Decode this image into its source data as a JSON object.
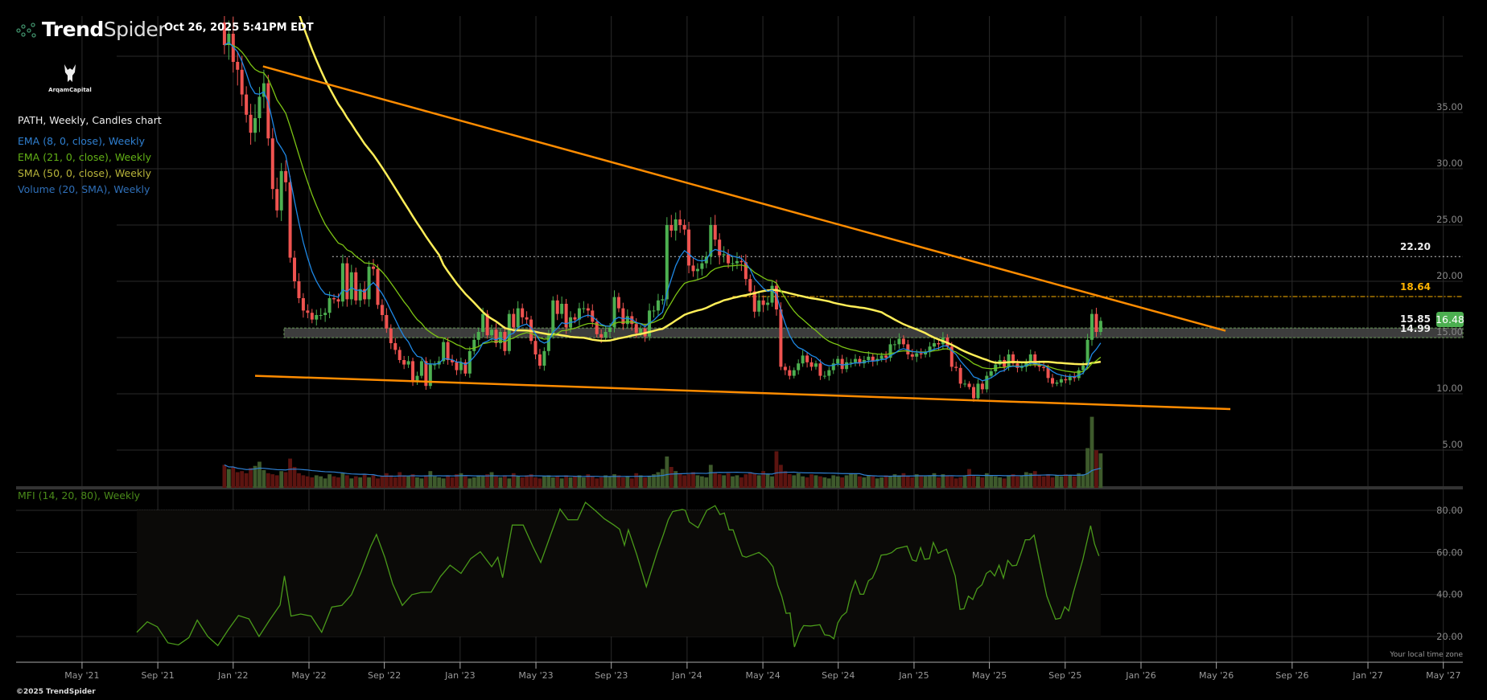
{
  "header": {
    "brand_bold": "Trend",
    "brand_light": "Spider",
    "timestamp": "Oct 26, 2025 5:41PM EDT",
    "watermark": "ArqamCapital"
  },
  "legend": {
    "title": "PATH, Weekly, Candles chart",
    "items": [
      {
        "label": "EMA (8, 0, close), Weekly",
        "color": "#2f7fd0"
      },
      {
        "label": "EMA (21, 0, close), Weekly",
        "color": "#62b016"
      },
      {
        "label": "SMA (50, 0, close), Weekly",
        "color": "#b8b43a"
      },
      {
        "label": "Volume (20, SMA), Weekly",
        "color": "#2f6fb8"
      }
    ]
  },
  "mfi_panel": {
    "label": "MFI (14, 20, 80), Weekly"
  },
  "footer": {
    "timezone_note": "Your local time zone",
    "copyright": "©2025 TrendSpider"
  },
  "colors": {
    "up": "#4caf50",
    "down": "#ef5350",
    "ema8": "#1e88e5",
    "ema21": "#7cc414",
    "sma50": "#ffee58",
    "trend": "#ff8c00",
    "mfi": "#4a9a1a",
    "badge": "#4caf50"
  },
  "chart_data": {
    "type": "candlestick",
    "symbol": "PATH",
    "interval": "Weekly",
    "x_unit": "weeks",
    "first_candle_week": 20,
    "x_ticks": [
      {
        "label": "May '21",
        "week": -12.5
      },
      {
        "label": "Sep '21",
        "week": 4.8
      },
      {
        "label": "Jan '22",
        "week": 22.0
      },
      {
        "label": "May '22",
        "week": 39.3
      },
      {
        "label": "Sep '22",
        "week": 56.5
      },
      {
        "label": "Jan '23",
        "week": 73.8
      },
      {
        "label": "May '23",
        "week": 91.1
      },
      {
        "label": "Sep '23",
        "week": 108.3
      },
      {
        "label": "Jan '24",
        "week": 125.6
      },
      {
        "label": "May '24",
        "week": 142.9
      },
      {
        "label": "Sep '24",
        "week": 160.1
      },
      {
        "label": "Jan '25",
        "week": 177.4
      },
      {
        "label": "May '25",
        "week": 194.6
      },
      {
        "label": "Sep '25",
        "week": 211.9
      },
      {
        "label": "Jan '26",
        "week": 229.2
      },
      {
        "label": "May '26",
        "week": 246.4
      },
      {
        "label": "Sep '26",
        "week": 263.7
      },
      {
        "label": "Jan '27",
        "week": 281.0
      },
      {
        "label": "May '27",
        "week": 298.2
      }
    ],
    "price_ticks": [
      "35.00",
      "30.00",
      "25.00",
      "20.00",
      "15.00",
      "10.00",
      "5.00"
    ],
    "price_gridlines": [
      40,
      35,
      30,
      25,
      20,
      15,
      10,
      5
    ],
    "mfi_ticks": [
      "80.00",
      "60.00",
      "40.00",
      "20.00"
    ],
    "first_open": 43,
    "closes": [
      41,
      42,
      39.5,
      38.8,
      36.6,
      34.8,
      33.2,
      34.5,
      36.4,
      37.6,
      32.7,
      28.2,
      26.3,
      29.8,
      28.8,
      22.1,
      20,
      18.5,
      17.4,
      17.2,
      16.6,
      17,
      17,
      17.2,
      18.5,
      18.4,
      18.2,
      21.6,
      18.4,
      20.8,
      18.3,
      19.3,
      18.4,
      21.3,
      21.1,
      17.9,
      17,
      15.8,
      14.5,
      13.9,
      13,
      12.6,
      12.9,
      11.1,
      11.6,
      12.9,
      10.7,
      12.6,
      12.6,
      12.9,
      14.6,
      13,
      12.8,
      12.1,
      12.8,
      11.8,
      13.8,
      14.8,
      15.5,
      17.1,
      15.2,
      15.7,
      14.5,
      15.5,
      13.8,
      17.1,
      15.9,
      17.6,
      16.8,
      16.6,
      14.7,
      13.5,
      12.5,
      13.8,
      15.2,
      18.3,
      17.1,
      18,
      15.9,
      16.8,
      16.6,
      17.6,
      17.6,
      17.4,
      16.4,
      15.3,
      15,
      15.5,
      15.9,
      18.6,
      17.6,
      16.2,
      16.9,
      16.2,
      15.4,
      15.8,
      15.1,
      17.4,
      17.4,
      18.3,
      18.4,
      25,
      24.5,
      25.5,
      25,
      24.6,
      21.4,
      20.9,
      21.1,
      21.6,
      22.2,
      25,
      23.7,
      22.3,
      22.4,
      21.6,
      21.6,
      21.8,
      21.7,
      20.2,
      19.1,
      17.3,
      18.3,
      17.9,
      18.1,
      19.6,
      17.5,
      12.4,
      12.1,
      11.6,
      12.1,
      12.7,
      13.4,
      12.8,
      12.4,
      12.7,
      11.6,
      11.6,
      12.1,
      12.7,
      13.1,
      12.2,
      12.8,
      12.8,
      13.1,
      12.7,
      13,
      13.3,
      12.9,
      13.1,
      13.4,
      13.2,
      14.4,
      14.4,
      14.9,
      14.4,
      13.5,
      13.3,
      13.6,
      13.5,
      13.7,
      14.2,
      14.5,
      14.4,
      15,
      14.2,
      12.4,
      12.3,
      10.9,
      10.9,
      10.6,
      9.6,
      10.9,
      10.4,
      11.6,
      12,
      12.6,
      13,
      12.4,
      13.5,
      12.7,
      12.3,
      12.4,
      12.8,
      13.5,
      12.6,
      12.4,
      12.3,
      11.4,
      10.9,
      11,
      11.3,
      11.2,
      11.5,
      11.4,
      12.1,
      12.5,
      14.8,
      17.1,
      15.5,
      16.48
    ],
    "volume_millions": [
      22,
      18,
      20,
      15,
      16,
      14,
      19,
      21,
      25,
      17,
      14,
      13,
      12,
      16,
      15,
      28,
      20,
      14,
      12,
      11,
      10,
      12,
      11,
      9,
      13,
      11,
      10,
      14,
      12,
      9,
      11,
      10,
      13,
      10,
      12,
      9,
      11,
      14,
      12,
      10,
      15,
      12,
      11,
      13,
      10,
      9,
      12,
      16,
      11,
      10,
      9,
      12,
      10,
      13,
      14,
      11,
      9,
      10,
      12,
      11,
      13,
      15,
      11,
      10,
      12,
      9,
      14,
      11,
      10,
      12,
      13,
      10,
      9,
      11,
      12,
      10,
      11,
      9,
      12,
      10,
      11,
      12,
      10,
      13,
      11,
      9,
      10,
      12,
      11,
      13,
      12,
      10,
      11,
      9,
      14,
      12,
      10,
      11,
      13,
      15,
      18,
      30,
      20,
      16,
      14,
      12,
      13,
      15,
      12,
      11,
      10,
      22,
      15,
      13,
      12,
      14,
      11,
      12,
      10,
      13,
      15,
      14,
      12,
      16,
      13,
      11,
      35,
      22,
      16,
      13,
      12,
      14,
      11,
      10,
      13,
      12,
      11,
      10,
      9,
      12,
      11,
      10,
      12,
      14,
      13,
      11,
      10,
      12,
      11,
      9,
      10,
      12,
      11,
      13,
      12,
      14,
      11,
      10,
      13,
      12,
      11,
      12,
      14,
      10,
      13,
      12,
      11,
      9,
      10,
      12,
      18,
      12,
      11,
      10,
      14,
      12,
      11,
      10,
      9,
      12,
      13,
      11,
      12,
      15,
      14,
      16,
      12,
      11,
      13,
      10,
      12,
      11,
      13,
      12,
      11,
      14,
      13,
      38,
      68,
      36,
      33
    ],
    "mfi": [
      [
        0,
        22
      ],
      [
        2.4,
        27
      ],
      [
        4.7,
        24.6
      ],
      [
        7.1,
        17
      ],
      [
        9.5,
        16
      ],
      [
        11.9,
        19.5
      ],
      [
        13.8,
        27.8
      ],
      [
        16.2,
        20
      ],
      [
        18.5,
        15.7
      ],
      [
        20.9,
        23.3
      ],
      [
        23.2,
        30
      ],
      [
        25.6,
        28.4
      ],
      [
        27.9,
        20
      ],
      [
        30.3,
        27.8
      ],
      [
        32.7,
        35
      ],
      [
        33.7,
        48.8
      ],
      [
        35.2,
        29.7
      ],
      [
        37.4,
        30.7
      ],
      [
        39.8,
        29.7
      ],
      [
        42.2,
        22
      ],
      [
        44.5,
        34
      ],
      [
        46.8,
        34.8
      ],
      [
        49,
        39.9
      ],
      [
        51.2,
        50.7
      ],
      [
        53.4,
        62.8
      ],
      [
        54.7,
        68.5
      ],
      [
        56.6,
        57.7
      ],
      [
        58.4,
        45
      ],
      [
        60.6,
        34.8
      ],
      [
        62.8,
        39.9
      ],
      [
        65,
        41
      ],
      [
        67.2,
        41.1
      ],
      [
        69.3,
        48.5
      ],
      [
        71.5,
        53.9
      ],
      [
        74,
        50
      ],
      [
        76.2,
        57
      ],
      [
        78.4,
        60.3
      ],
      [
        81,
        53.2
      ],
      [
        82.4,
        57.7
      ],
      [
        83.5,
        48
      ],
      [
        85.7,
        73
      ],
      [
        88.2,
        73
      ],
      [
        90.4,
        62.8
      ],
      [
        92.2,
        55.2
      ],
      [
        94.4,
        68
      ],
      [
        96.6,
        80.6
      ],
      [
        98.4,
        75.5
      ],
      [
        100.6,
        75.5
      ],
      [
        102.4,
        83.8
      ],
      [
        104.6,
        80
      ],
      [
        106.7,
        76
      ],
      [
        108.9,
        73
      ],
      [
        110.2,
        71
      ],
      [
        111.3,
        63.4
      ],
      [
        112.2,
        70.7
      ],
      [
        114.1,
        59
      ],
      [
        116.3,
        43.7
      ],
      [
        118.8,
        60.3
      ],
      [
        120.2,
        68.5
      ],
      [
        121.3,
        75.5
      ],
      [
        122.3,
        79.4
      ],
      [
        124.5,
        80.4
      ],
      [
        125.2,
        80
      ],
      [
        126.1,
        74.5
      ],
      [
        128.1,
        71.7
      ],
      [
        130.1,
        80
      ],
      [
        132,
        82.2
      ],
      [
        133.1,
        78
      ],
      [
        134.1,
        78.7
      ],
      [
        135.2,
        70.7
      ],
      [
        136.1,
        70.7
      ],
      [
        137.2,
        64
      ],
      [
        138.2,
        58.3
      ],
      [
        139.1,
        57.7
      ],
      [
        142,
        60
      ],
      [
        143.8,
        57
      ],
      [
        145.2,
        53.2
      ],
      [
        146.3,
        44.3
      ],
      [
        147.2,
        39.2
      ],
      [
        148.2,
        31
      ],
      [
        149.1,
        31.2
      ],
      [
        150.1,
        15
      ],
      [
        151.3,
        22
      ],
      [
        152.2,
        25.2
      ],
      [
        153.8,
        25
      ],
      [
        155.9,
        25.6
      ],
      [
        157,
        20.8
      ],
      [
        158.1,
        20.5
      ],
      [
        159.1,
        18.9
      ],
      [
        160,
        26.5
      ],
      [
        160.9,
        29.7
      ],
      [
        162,
        31.6
      ],
      [
        163,
        40.5
      ],
      [
        164,
        46.5
      ],
      [
        165.1,
        40.1
      ],
      [
        165.9,
        40.1
      ],
      [
        167,
        46.5
      ],
      [
        167.9,
        47.8
      ],
      [
        168.8,
        52
      ],
      [
        169.9,
        58.7
      ],
      [
        171.1,
        59
      ],
      [
        172.3,
        59.9
      ],
      [
        173.4,
        61.8
      ],
      [
        175.8,
        63
      ],
      [
        177,
        56.4
      ],
      [
        177.9,
        55.8
      ],
      [
        178.9,
        62.2
      ],
      [
        179.8,
        56.7
      ],
      [
        180.9,
        57
      ],
      [
        181.8,
        64.7
      ],
      [
        182.9,
        59.6
      ],
      [
        184.8,
        61.5
      ],
      [
        186.8,
        48.8
      ],
      [
        187.9,
        32.9
      ],
      [
        188.8,
        33.2
      ],
      [
        189.8,
        39.2
      ],
      [
        190.8,
        37.6
      ],
      [
        191.8,
        42.7
      ],
      [
        192.9,
        44.6
      ],
      [
        193.9,
        50
      ],
      [
        194.8,
        51.3
      ],
      [
        195.8,
        48.8
      ],
      [
        196.8,
        53.9
      ],
      [
        197.8,
        47.8
      ],
      [
        198.8,
        56.2
      ],
      [
        199.8,
        53.6
      ],
      [
        200.8,
        53.9
      ],
      [
        201.8,
        59.6
      ],
      [
        202.8,
        66
      ],
      [
        203.8,
        66
      ],
      [
        204.8,
        68.2
      ],
      [
        205.9,
        57
      ],
      [
        207.7,
        39.2
      ],
      [
        209.7,
        28.2
      ],
      [
        210.8,
        28.7
      ],
      [
        211.8,
        34.1
      ],
      [
        212.7,
        32.2
      ],
      [
        213.8,
        41.1
      ],
      [
        215.9,
        56.4
      ],
      [
        217.7,
        72.7
      ],
      [
        218.6,
        64
      ],
      [
        219.6,
        58.3
      ]
    ],
    "trendlines": [
      {
        "name": "upper-resistance",
        "from": {
          "week": 28.8,
          "price": 39.1
        },
        "to": {
          "week": 248.5,
          "price": 15.6
        }
      },
      {
        "name": "lower-support",
        "from": {
          "week": 27.0,
          "price": 11.6
        },
        "to": {
          "week": 249.6,
          "price": 8.64
        }
      }
    ],
    "levels": [
      {
        "label": "22.20",
        "price": 22.2,
        "from_week": 44.6,
        "style": "dotted",
        "color": "#cccccc"
      },
      {
        "label": "18.64",
        "price": 18.64,
        "from_week": 136,
        "style": "dashdot",
        "color": "#ffb300"
      }
    ],
    "zone": {
      "top_label": "15.85",
      "bottom_label": "14.99",
      "top": 15.85,
      "bottom": 14.99,
      "from_week": 33.6
    },
    "last_price": "16.48"
  }
}
